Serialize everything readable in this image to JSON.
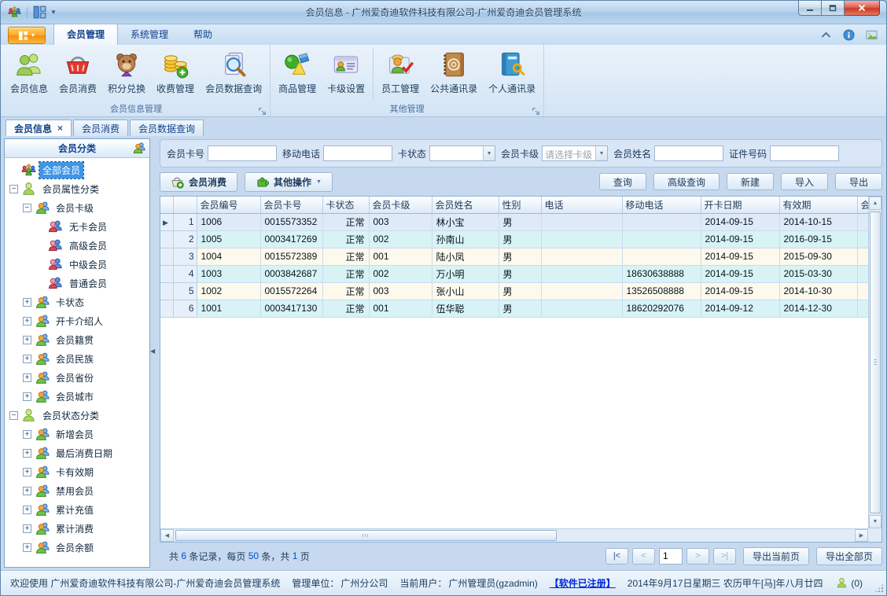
{
  "window": {
    "title": "会员信息 - 广州爱奇迪软件科技有限公司-广州爱奇迪会员管理系统"
  },
  "ribbon": {
    "tabs": [
      {
        "label": "会员管理",
        "active": true
      },
      {
        "label": "系统管理",
        "active": false
      },
      {
        "label": "帮助",
        "active": false
      }
    ],
    "groups": [
      {
        "label": "会员信息管理",
        "buttons": [
          {
            "label": "会员信息",
            "icon": "members"
          },
          {
            "label": "会员消费",
            "icon": "basket"
          },
          {
            "label": "积分兑换",
            "icon": "bear"
          },
          {
            "label": "收费管理",
            "icon": "coins"
          },
          {
            "label": "会员数据查询",
            "icon": "doc-search"
          }
        ]
      },
      {
        "label": "其他管理",
        "buttons": [
          {
            "label": "商品管理",
            "icon": "shapes"
          },
          {
            "label": "卡级设置",
            "icon": "card"
          },
          {
            "label": "员工管理",
            "icon": "staff",
            "sep_before": true
          },
          {
            "label": "公共通讯录",
            "icon": "book-at"
          },
          {
            "label": "个人通讯录",
            "icon": "book-key"
          }
        ]
      }
    ]
  },
  "doc_tabs": [
    {
      "label": "会员信息",
      "active": true,
      "closable": true
    },
    {
      "label": "会员消费",
      "active": false
    },
    {
      "label": "会员数据查询",
      "active": false
    }
  ],
  "sidebar": {
    "header": "会员分类",
    "tree": [
      {
        "label": "全部会员",
        "icon": "crowd",
        "level": 0,
        "expander": "none",
        "selected": true
      },
      {
        "label": "会员属性分类",
        "icon": "person-green",
        "level": 0,
        "expander": "minus"
      },
      {
        "label": "会员卡级",
        "icon": "person-duo",
        "level": 1,
        "expander": "minus"
      },
      {
        "label": "无卡会员",
        "icon": "person-pair",
        "level": 2,
        "expander": "none"
      },
      {
        "label": "高级会员",
        "icon": "person-pair",
        "level": 2,
        "expander": "none"
      },
      {
        "label": "中级会员",
        "icon": "person-pair",
        "level": 2,
        "expander": "none"
      },
      {
        "label": "普通会员",
        "icon": "person-pair",
        "level": 2,
        "expander": "none"
      },
      {
        "label": "卡状态",
        "icon": "person-duo",
        "level": 1,
        "expander": "plus"
      },
      {
        "label": "开卡介绍人",
        "icon": "person-duo",
        "level": 1,
        "expander": "plus"
      },
      {
        "label": "会员籍贯",
        "icon": "person-duo",
        "level": 1,
        "expander": "plus"
      },
      {
        "label": "会员民族",
        "icon": "person-duo",
        "level": 1,
        "expander": "plus"
      },
      {
        "label": "会员省份",
        "icon": "person-duo",
        "level": 1,
        "expander": "plus"
      },
      {
        "label": "会员城市",
        "icon": "person-duo",
        "level": 1,
        "expander": "plus"
      },
      {
        "label": "会员状态分类",
        "icon": "person-green",
        "level": 0,
        "expander": "minus"
      },
      {
        "label": "新增会员",
        "icon": "person-duo",
        "level": 1,
        "expander": "plus"
      },
      {
        "label": "最后消费日期",
        "icon": "person-duo",
        "level": 1,
        "expander": "plus"
      },
      {
        "label": "卡有效期",
        "icon": "person-duo",
        "level": 1,
        "expander": "plus"
      },
      {
        "label": "禁用会员",
        "icon": "person-duo",
        "level": 1,
        "expander": "plus"
      },
      {
        "label": "累计充值",
        "icon": "person-duo",
        "level": 1,
        "expander": "plus"
      },
      {
        "label": "累计消费",
        "icon": "person-duo",
        "level": 1,
        "expander": "plus"
      },
      {
        "label": "会员余额",
        "icon": "person-duo",
        "level": 1,
        "expander": "plus"
      }
    ]
  },
  "search": {
    "fields": [
      {
        "label": "会员卡号",
        "type": "text",
        "value": ""
      },
      {
        "label": "移动电话",
        "type": "text",
        "value": ""
      },
      {
        "label": "卡状态",
        "type": "select",
        "value": ""
      },
      {
        "label": "会员卡级",
        "type": "select",
        "value": "请选择卡级",
        "is_placeholder": true
      },
      {
        "label": "会员姓名",
        "type": "text",
        "value": ""
      },
      {
        "label": "证件号码",
        "type": "text",
        "value": ""
      }
    ]
  },
  "actions": {
    "left": [
      {
        "label": "会员消费",
        "icon": "basket-add"
      },
      {
        "label": "其他操作",
        "icon": "puzzle",
        "dropdown": true
      }
    ],
    "right": [
      "查询",
      "高级查询",
      "新建",
      "导入",
      "导出"
    ]
  },
  "table": {
    "columns": [
      "会员编号",
      "会员卡号",
      "卡状态",
      "会员卡级",
      "会员姓名",
      "性别",
      "电话",
      "移动电话",
      "开卡日期",
      "有效期",
      "会员"
    ],
    "rows": [
      {
        "num": "1",
        "current": true,
        "cells": [
          "1006",
          "0015573352",
          "正常",
          "003",
          "林小宝",
          "男",
          "",
          "",
          "2014-09-15",
          "2014-10-15",
          ""
        ]
      },
      {
        "num": "2",
        "current": false,
        "cells": [
          "1005",
          "0003417269",
          "正常",
          "002",
          "孙南山",
          "男",
          "",
          "",
          "2014-09-15",
          "2016-09-15",
          ""
        ]
      },
      {
        "num": "3",
        "current": false,
        "cells": [
          "1004",
          "0015572389",
          "正常",
          "001",
          "陆小凤",
          "男",
          "",
          "",
          "2014-09-15",
          "2015-09-30",
          ""
        ]
      },
      {
        "num": "4",
        "current": false,
        "cells": [
          "1003",
          "0003842687",
          "正常",
          "002",
          "万小明",
          "男",
          "",
          "18630638888",
          "2014-09-15",
          "2015-03-30",
          ""
        ]
      },
      {
        "num": "5",
        "current": false,
        "cells": [
          "1002",
          "0015572264",
          "正常",
          "003",
          "张小山",
          "男",
          "",
          "13526508888",
          "2014-09-15",
          "2014-10-30",
          ""
        ]
      },
      {
        "num": "6",
        "current": false,
        "cells": [
          "1001",
          "0003417130",
          "正常",
          "001",
          "伍华聪",
          "男",
          "",
          "18620292076",
          "2014-09-12",
          "2014-12-30",
          ""
        ]
      }
    ]
  },
  "footer": {
    "seg1": "共 ",
    "count": "6",
    "seg2": " 条记录，每页 ",
    "per_page": "50",
    "seg3": " 条，共 ",
    "pages": "1",
    "seg4": " 页",
    "pager": {
      "first": "|<",
      "prev": "<",
      "page": "1",
      "next": ">",
      "last": ">|"
    },
    "export_current": "导出当前页",
    "export_all": "导出全部页"
  },
  "statusbar": {
    "welcome": "欢迎使用 广州爱奇迪软件科技有限公司-广州爱奇迪会员管理系统",
    "org_label": "管理单位：",
    "org": "广州分公司",
    "user_label": "当前用户：",
    "user": "广州管理员(gzadmin)",
    "license": "【软件已注册】",
    "datetime": "2014年9月17日星期三 农历甲午[马]年八月廿四",
    "messages": "(0)"
  },
  "colors": {
    "accent_orange": "#f59008",
    "tab_text": "#15428b",
    "row_cyan": "#d8f3f6",
    "row_cream": "#fdf9ec",
    "row_current": "#dfeaf8",
    "link_blue": "#0026e0"
  }
}
